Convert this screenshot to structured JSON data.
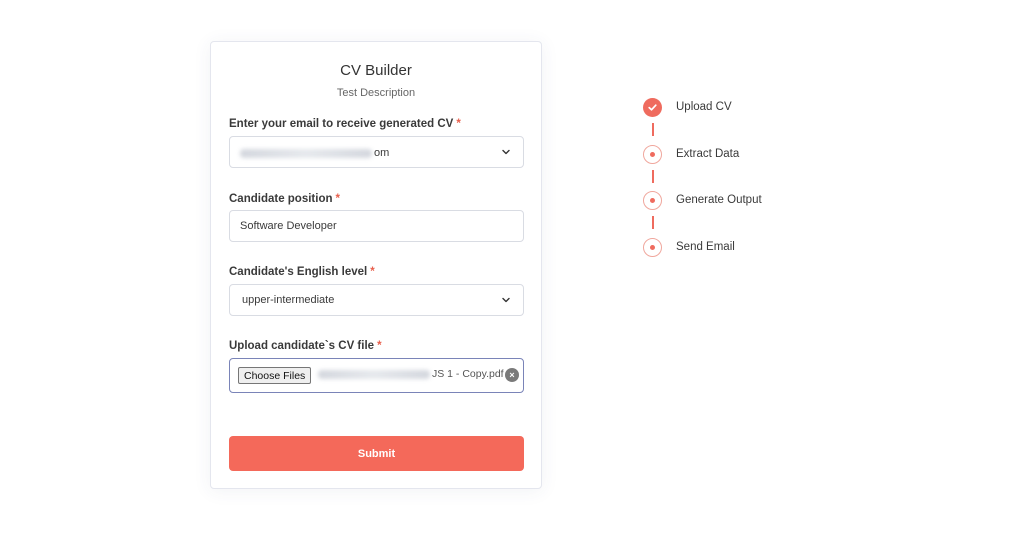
{
  "form": {
    "title": "CV Builder",
    "description": "Test Description",
    "email": {
      "label": "Enter your email to receive generated CV",
      "required_mark": "*",
      "value_visible_suffix": "om"
    },
    "position": {
      "label": "Candidate position",
      "required_mark": "*",
      "value": "Software Developer"
    },
    "english": {
      "label": "Candidate's English level",
      "required_mark": "*",
      "value": "upper-intermediate"
    },
    "cv_file": {
      "label": "Upload candidate`s CV file",
      "required_mark": "*",
      "choose_label": "Choose Files",
      "file_name_visible_suffix": "JS 1 - Copy.pdf",
      "clear_glyph": "×"
    },
    "submit_label": "Submit"
  },
  "steps": [
    {
      "label": "Upload CV",
      "status": "done"
    },
    {
      "label": "Extract Data",
      "status": "pending"
    },
    {
      "label": "Generate Output",
      "status": "pending"
    },
    {
      "label": "Send Email",
      "status": "pending"
    }
  ],
  "colors": {
    "accent": "#f4695a",
    "step_accent": "#ef6b5e",
    "focus_border": "#7a84b8"
  }
}
